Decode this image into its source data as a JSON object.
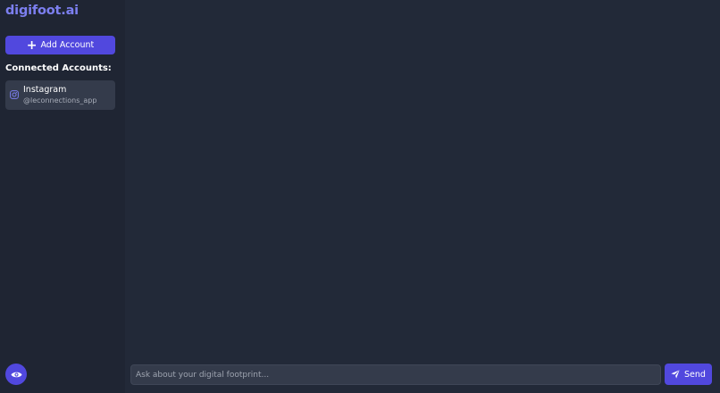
{
  "brand": {
    "title": "digifoot.ai"
  },
  "sidebar": {
    "add_account_label": "Add Account",
    "connected_title": "Connected Accounts:",
    "accounts": [
      {
        "platform": "Instagram",
        "handle": "@leconnections_app",
        "icon": "instagram-icon"
      }
    ],
    "footer_icon": "eye-icon"
  },
  "chat": {
    "placeholder": "Ask about your digital footprint...",
    "value": "",
    "send_label": "Send",
    "send_icon": "paper-plane-icon"
  },
  "colors": {
    "accent": "#5148de",
    "brand": "#7c7ff0",
    "background": "#222938",
    "sidebar": "#1f2533",
    "card": "#343b4b"
  }
}
